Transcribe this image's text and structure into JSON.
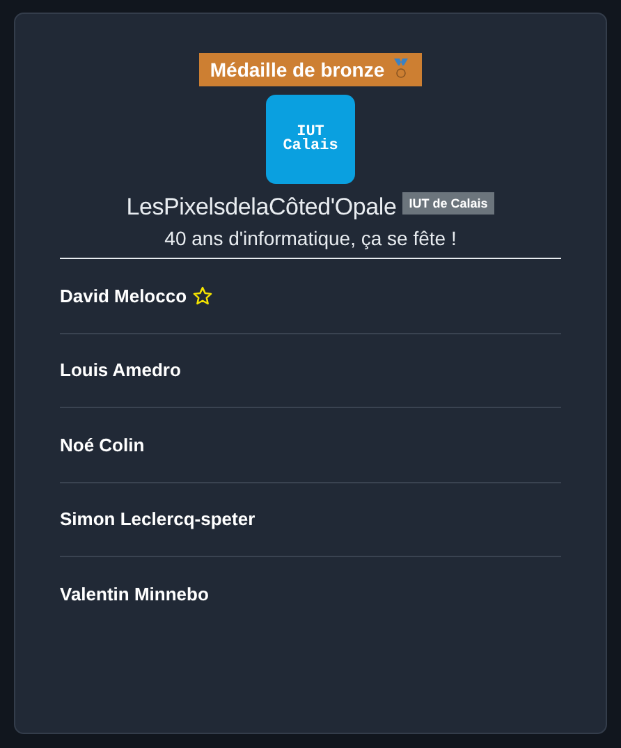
{
  "award": {
    "label": "Médaille de bronze"
  },
  "team": {
    "logo_text": [
      "IUT",
      "Calais"
    ],
    "name": "LesPixelsdelaCôted'Opale",
    "school_badge": "IUT de Calais",
    "motto": "40 ans d'informatique, ça se fête !"
  },
  "members": [
    {
      "name": "David Melocco",
      "leader": true
    },
    {
      "name": "Louis Amedro",
      "leader": false
    },
    {
      "name": "Noé Colin",
      "leader": false
    },
    {
      "name": "Simon Leclercq-speter",
      "leader": false
    },
    {
      "name": "Valentin Minnebo",
      "leader": false
    }
  ]
}
